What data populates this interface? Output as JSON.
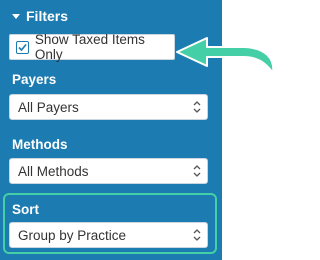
{
  "filters": {
    "title": "Filters",
    "show_taxed_label": "Show Taxed Items Only",
    "show_taxed_checked": true
  },
  "payers": {
    "label": "Payers",
    "selected": "All Payers"
  },
  "methods": {
    "label": "Methods",
    "selected": "All Methods"
  },
  "sort": {
    "label": "Sort",
    "selected": "Group by Practice"
  },
  "colors": {
    "panel": "#1c7bb0",
    "highlight": "#44cfa6"
  }
}
